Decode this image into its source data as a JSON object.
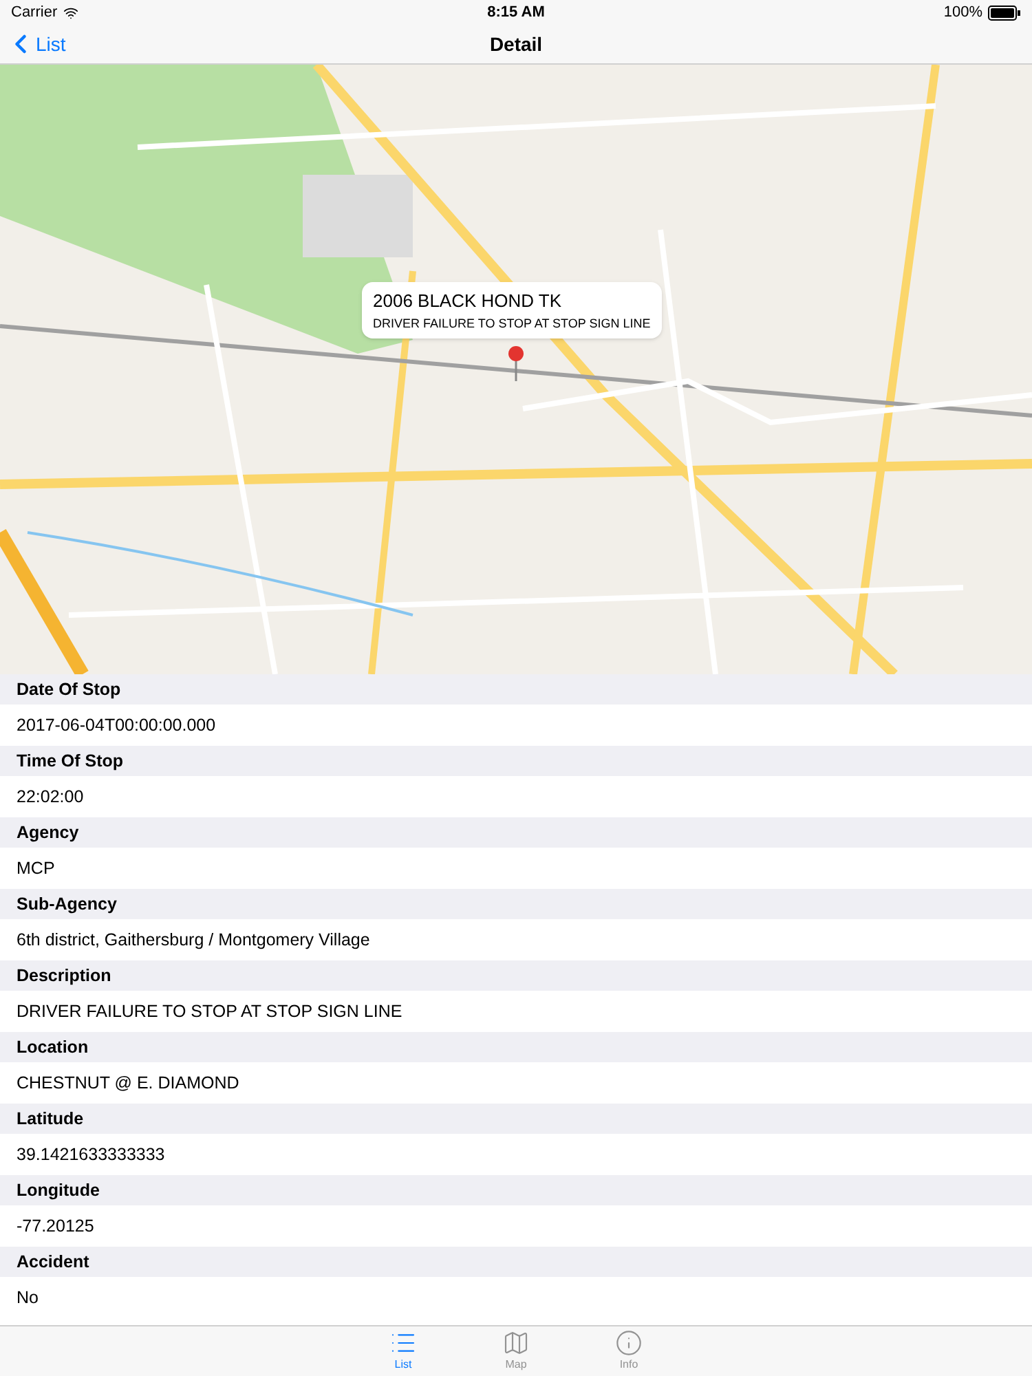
{
  "status_bar": {
    "carrier": "Carrier",
    "time": "8:15 AM",
    "battery": "100%"
  },
  "nav": {
    "back": "List",
    "title": "Detail"
  },
  "map": {
    "callout": {
      "title": "2006 BLACK HOND TK",
      "subtitle": "DRIVER FAILURE TO STOP AT STOP SIGN LINE"
    }
  },
  "fields": [
    {
      "label": "Date Of Stop",
      "value": "2017-06-04T00:00:00.000"
    },
    {
      "label": "Time Of Stop",
      "value": "22:02:00"
    },
    {
      "label": "Agency",
      "value": "MCP"
    },
    {
      "label": "Sub-Agency",
      "value": "6th district, Gaithersburg / Montgomery Village"
    },
    {
      "label": "Description",
      "value": "DRIVER FAILURE TO STOP AT STOP SIGN LINE"
    },
    {
      "label": "Location",
      "value": "CHESTNUT @  E. DIAMOND"
    },
    {
      "label": "Latitude",
      "value": "39.1421633333333"
    },
    {
      "label": "Longitude",
      "value": "-77.20125"
    },
    {
      "label": "Accident",
      "value": "No"
    }
  ],
  "tabs": [
    {
      "label": "List",
      "kind": "list",
      "selected": true
    },
    {
      "label": "Map",
      "kind": "map",
      "selected": false
    },
    {
      "label": "Info",
      "kind": "info",
      "selected": false
    }
  ]
}
